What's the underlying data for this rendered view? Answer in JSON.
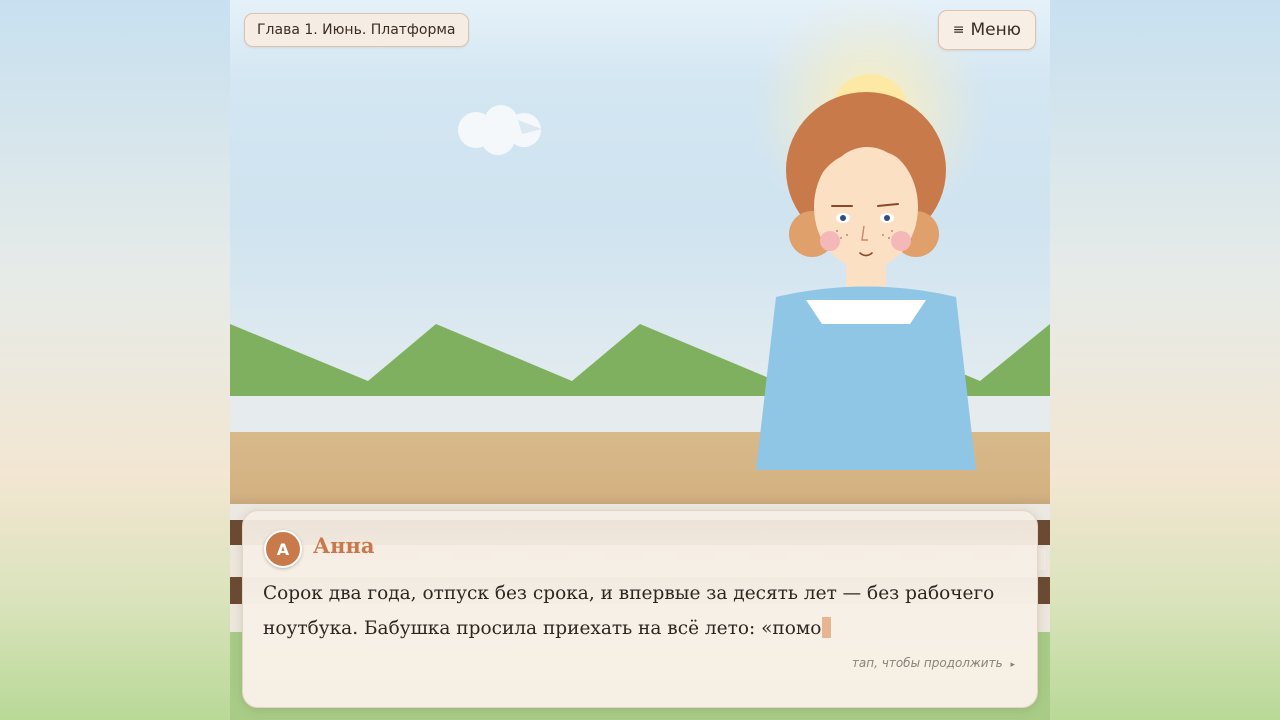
{
  "chapter": {
    "title": "Глава 1. Июнь. Платформа"
  },
  "menu": {
    "icon": "≡",
    "icon_name": "hamburger-menu-icon",
    "label": "Меню"
  },
  "dialog": {
    "avatar_letter": "А",
    "speaker": "Анна",
    "text": "Сорок два года, отпуск без срока, и впервые за десять лет — без рабочего ноутбука. Бабушка просила приехать на всё лето: «помо",
    "hint": "тап, чтобы продолжить",
    "hint_icon": "▸"
  },
  "colors": {
    "accent": "#c97a4a",
    "speaker_name": "#c9784a",
    "dress": "#8fc6e6",
    "hills": "#7fb060",
    "platform": "#d7b686",
    "hair": "#c97a4a"
  }
}
